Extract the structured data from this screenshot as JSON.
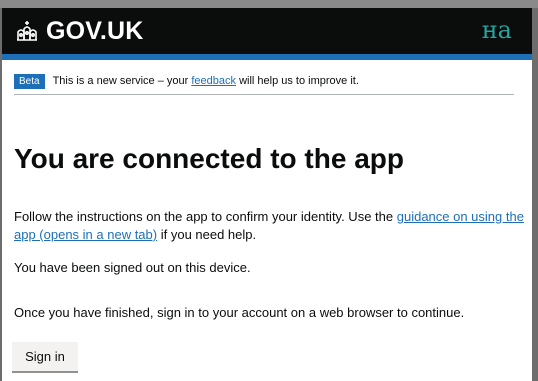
{
  "header": {
    "logo_text": "GOV.UK",
    "language_label": "на"
  },
  "phase_banner": {
    "tag": "Beta",
    "text_before": "This is a new service – your ",
    "link": "feedback",
    "text_after": " will help us to improve it."
  },
  "main": {
    "title": "You are connected to the app",
    "p1_before": "Follow the instructions on the app to confirm your identity. Use the ",
    "p1_link": "guidance on using the app (opens in a new tab)",
    "p1_after": " if you need help.",
    "p2": "You have been signed out on this device.",
    "p3": "Once you have finished, sign in to your account on a web browser to continue.",
    "button": "Sign in"
  },
  "colors": {
    "header_bg": "#0b0c0c",
    "brand_blue": "#1d70b8",
    "link": "#1d70b8"
  },
  "icons": [
    "crown-icon"
  ]
}
